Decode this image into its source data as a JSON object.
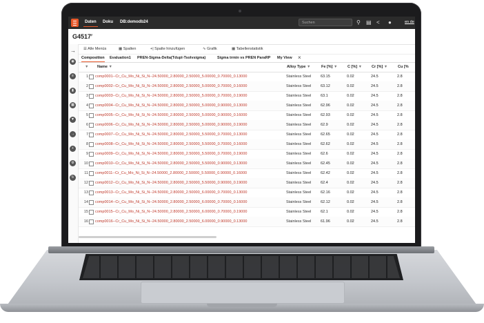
{
  "app": {
    "top_tabs": [
      "Daten",
      "Doku",
      "DB:demodb24"
    ],
    "search_placeholder": "Suchen",
    "language": "en de",
    "record_title": "G4517"
  },
  "toolbar": {
    "buttons": [
      "Alle Menüs",
      "Spalten",
      "Spalte hinzufügen",
      "Grafik",
      "Tabellenstatistik"
    ]
  },
  "tabs": [
    "Composition",
    "Evaluation1",
    "PREN-Sigma-Delta(Tdupl-Tsolvsigma)",
    "Sigma trmin vs PREN ParaRP",
    "My View"
  ],
  "grid": {
    "headers": [
      "Name",
      "Alloy Type",
      "Fe [%]",
      "C [%]",
      "Cr [%]",
      "Cu [%"
    ],
    "rows": [
      {
        "idx": "1",
        "name": "comp0001--Cr_Cu_Mo_Ni_Si_N--24.50000_2.80000_2.50000_5.00000_0.70000_0.13000",
        "alloy": "Stainless Steel",
        "fe": "63.15",
        "c": "0.02",
        "cr": "24.5",
        "cu": "2.8"
      },
      {
        "idx": "2",
        "name": "comp0002--Cr_Cu_Mo_Ni_Si_N--24.50000_2.80000_2.50000_5.00000_0.70000_0.16000",
        "alloy": "Stainless Steel",
        "fe": "63.12",
        "c": "0.02",
        "cr": "24.5",
        "cu": "2.8"
      },
      {
        "idx": "3",
        "name": "comp0003--Cr_Cu_Mo_Ni_Si_N--24.50000_2.80000_2.50000_5.00000_0.70000_0.19000",
        "alloy": "Stainless Steel",
        "fe": "63.1",
        "c": "0.02",
        "cr": "24.5",
        "cu": "2.8"
      },
      {
        "idx": "4",
        "name": "comp0004--Cr_Cu_Mo_Ni_Si_N--24.50000_2.80000_2.50000_5.00000_0.90000_0.13000",
        "alloy": "Stainless Steel",
        "fe": "62.96",
        "c": "0.02",
        "cr": "24.5",
        "cu": "2.8"
      },
      {
        "idx": "5",
        "name": "comp0005--Cr_Cu_Mo_Ni_Si_N--24.50000_2.80000_2.50000_5.00000_0.90000_0.16000",
        "alloy": "Stainless Steel",
        "fe": "62.93",
        "c": "0.02",
        "cr": "24.5",
        "cu": "2.8"
      },
      {
        "idx": "6",
        "name": "comp0006--Cr_Cu_Mo_Ni_Si_N--24.50000_2.80000_2.50000_5.00000_0.90000_0.19000",
        "alloy": "Stainless Steel",
        "fe": "62.9",
        "c": "0.02",
        "cr": "24.5",
        "cu": "2.8"
      },
      {
        "idx": "7",
        "name": "comp0007--Cr_Cu_Mo_Ni_Si_N--24.50000_2.80000_2.50000_5.50000_0.70000_0.13000",
        "alloy": "Stainless Steel",
        "fe": "62.65",
        "c": "0.02",
        "cr": "24.5",
        "cu": "2.8"
      },
      {
        "idx": "8",
        "name": "comp0008--Cr_Cu_Mo_Ni_Si_N--24.50000_2.80000_2.50000_5.50000_0.70000_0.16000",
        "alloy": "Stainless Steel",
        "fe": "62.62",
        "c": "0.02",
        "cr": "24.5",
        "cu": "2.8"
      },
      {
        "idx": "9",
        "name": "comp0009--Cr_Cu_Mo_Ni_Si_N--24.50000_2.80000_2.50000_5.50000_0.70000_0.19000",
        "alloy": "Stainless Steel",
        "fe": "62.6",
        "c": "0.02",
        "cr": "24.5",
        "cu": "2.8"
      },
      {
        "idx": "10",
        "name": "comp0010--Cr_Cu_Mo_Ni_Si_N--24.50000_2.80000_2.50000_5.50000_0.90000_0.13000",
        "alloy": "Stainless Steel",
        "fe": "62.45",
        "c": "0.02",
        "cr": "24.5",
        "cu": "2.8"
      },
      {
        "idx": "11",
        "name": "comp0011--Cr_Cu_Mo_Ni_Si_N--24.50000_2.80000_2.50000_5.50000_0.90000_0.16000",
        "alloy": "Stainless Steel",
        "fe": "62.42",
        "c": "0.02",
        "cr": "24.5",
        "cu": "2.8"
      },
      {
        "idx": "12",
        "name": "comp0012--Cr_Cu_Mo_Ni_Si_N--24.50000_2.80000_2.50000_5.50000_0.90000_0.19000",
        "alloy": "Stainless Steel",
        "fe": "62.4",
        "c": "0.02",
        "cr": "24.5",
        "cu": "2.8"
      },
      {
        "idx": "13",
        "name": "comp0013--Cr_Cu_Mo_Ni_Si_N--24.50000_2.80000_2.50000_6.00000_0.70000_0.13000",
        "alloy": "Stainless Steel",
        "fe": "62.16",
        "c": "0.02",
        "cr": "24.5",
        "cu": "2.8"
      },
      {
        "idx": "14",
        "name": "comp0014--Cr_Cu_Mo_Ni_Si_N--24.50000_2.80000_2.50000_6.00000_0.70000_0.16000",
        "alloy": "Stainless Steel",
        "fe": "62.12",
        "c": "0.02",
        "cr": "24.5",
        "cu": "2.8"
      },
      {
        "idx": "15",
        "name": "comp0015--Cr_Cu_Mo_Ni_Si_N--24.50000_2.80000_2.50000_6.00000_0.70000_0.19000",
        "alloy": "Stainless Steel",
        "fe": "62.1",
        "c": "0.02",
        "cr": "24.5",
        "cu": "2.8"
      },
      {
        "idx": "16",
        "name": "comp0016--Cr_Cu_Mo_Ni_Si_N--24.50000_2.80000_2.50000_6.00000_0.90000_0.13000",
        "alloy": "Stainless Steel",
        "fe": "61.96",
        "c": "0.02",
        "cr": "24.5",
        "cu": "2.8"
      }
    ]
  },
  "icons": {
    "topbar": [
      "search-icon",
      "database-icon",
      "share-icon",
      "user-icon"
    ],
    "sidebar": [
      "arrow-right-icon",
      "view-icon",
      "list-icon",
      "chart-icon",
      "table-icon",
      "filter-icon",
      "export-icon",
      "add-icon",
      "settings-icon",
      "refresh-icon"
    ]
  },
  "colors": {
    "accent": "#e8592b",
    "topbar": "#2b2b2b",
    "link": "#c0392b"
  }
}
